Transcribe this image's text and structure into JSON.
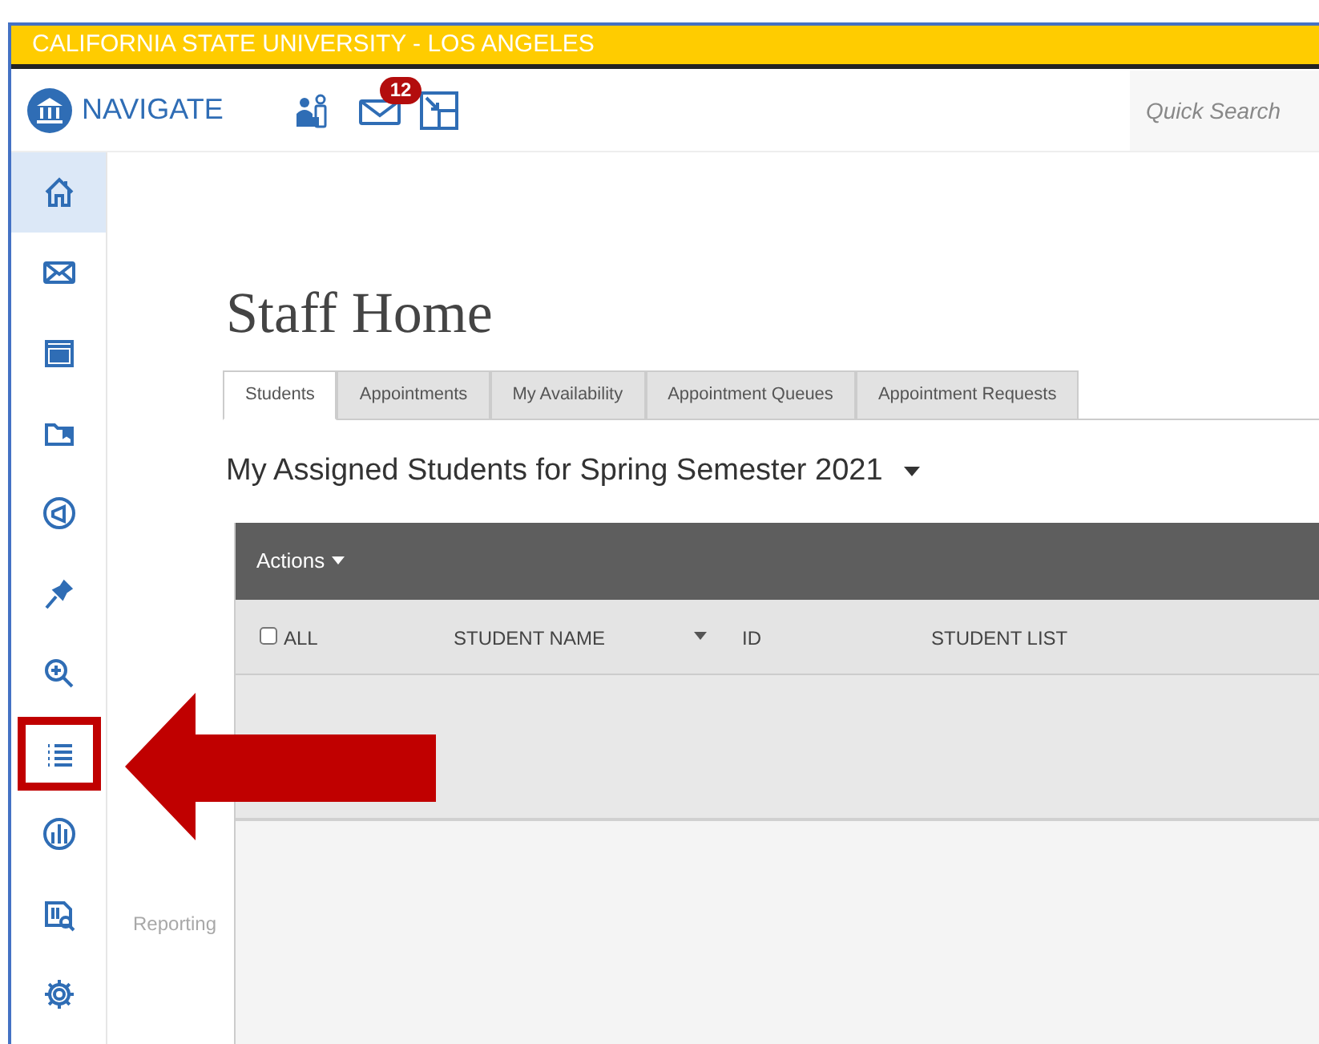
{
  "banner": "CALIFORNIA STATE UNIVERSITY - LOS ANGELES",
  "header": {
    "brand": "NAVIGATE",
    "messages_badge": "12",
    "search": {
      "placeholder": "Quick Search"
    }
  },
  "sidebar": {
    "items": [
      {
        "kind": "home",
        "selected": true,
        "highlighted": false
      },
      {
        "kind": "mail",
        "selected": false,
        "highlighted": false
      },
      {
        "kind": "calendar",
        "selected": false,
        "highlighted": false
      },
      {
        "kind": "folder",
        "selected": false,
        "highlighted": false
      },
      {
        "kind": "megaphone",
        "selected": false,
        "highlighted": false
      },
      {
        "kind": "pin",
        "selected": false,
        "highlighted": false
      },
      {
        "kind": "zoom",
        "selected": false,
        "highlighted": false
      },
      {
        "kind": "list",
        "selected": false,
        "highlighted": true
      },
      {
        "kind": "chart",
        "selected": false,
        "highlighted": false
      },
      {
        "kind": "report",
        "selected": false,
        "highlighted": false
      },
      {
        "kind": "gear",
        "selected": false,
        "highlighted": false
      }
    ]
  },
  "tooltip": "Reporting",
  "title": "Staff Home",
  "tabs": [
    {
      "label": "Students",
      "selected": true
    },
    {
      "label": "Appointments",
      "selected": false
    },
    {
      "label": "My Availability",
      "selected": false
    },
    {
      "label": "Appointment Queues",
      "selected": false
    },
    {
      "label": "Appointment Requests",
      "selected": false
    }
  ],
  "subtitle": "My Assigned Students for Spring Semester 2021",
  "table": {
    "actions": "Actions",
    "columns": [
      {
        "label": "ALL",
        "kind": "checkbox",
        "checked": false,
        "sorted": false
      },
      {
        "label": "STUDENT NAME",
        "kind": "text",
        "sorted": true
      },
      {
        "label": "ID",
        "kind": "text",
        "sorted": false
      },
      {
        "label": "STUDENT LIST",
        "kind": "text",
        "sorted": false
      }
    ]
  }
}
